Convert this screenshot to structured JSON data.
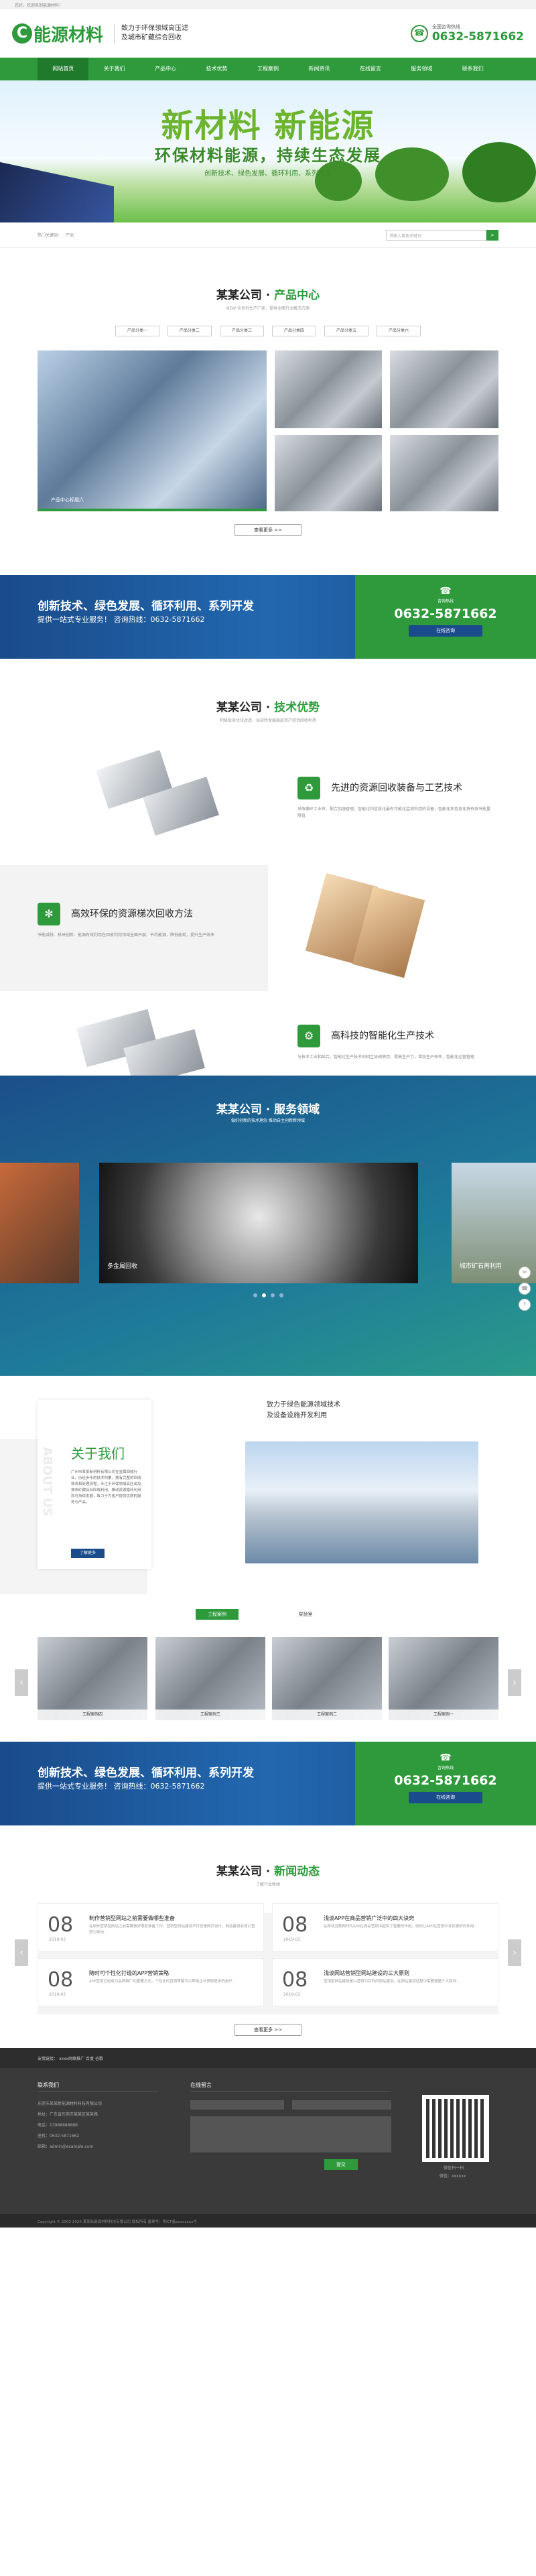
{
  "topbar": {
    "text": "您好，欢迎来到能源材料！"
  },
  "header": {
    "logo_letter": "C",
    "logo_name": "能源材料",
    "slogan_1": "致力于环保领域高压滤",
    "slogan_2": "及城市矿藏综合回收",
    "hotline_label": "全国咨询热线",
    "hotline": "0632-5871662"
  },
  "nav": [
    "网站首页",
    "关于我们",
    "产品中心",
    "技术优势",
    "工程案例",
    "新闻资讯",
    "在线留言",
    "服务领域",
    "联系我们"
  ],
  "banner": {
    "headline": "新材料 新能源",
    "subline": "环保材料能源，持续生态发展",
    "tags": "创新技术、绿色发展、循环利用、系列开发"
  },
  "search": {
    "hot_label": "热门关键词：",
    "hot_item": "产品",
    "placeholder": "请输入搜索关键词"
  },
  "products": {
    "title_a": "某某公司",
    "title_b": "产品中心",
    "sub_1": "NEW 全系列生产厂家，提供全面行业解决方案",
    "tabs": [
      "产品分类一",
      "产品分类二",
      "产品分类三",
      "产品分类四",
      "产品分类五",
      "产品分类六"
    ],
    "caption": "产品中心标题六",
    "more": "查看更多 >>"
  },
  "cta": {
    "line1": "创新技术、绿色发展、循环利用、系列开发",
    "line2": "提供一站式专业服务！ 咨询热线：0632-5871662",
    "label": "咨询热线",
    "phone": "0632-5871662",
    "button": "在线咨询"
  },
  "advantages": {
    "title_a": "某某公司",
    "title_b": "技术优势",
    "sub": "积极投身优化改造，治研所发展高层资产综合回收利用",
    "items": [
      {
        "title": "先进的资源回收装备与工艺技术",
        "desc": "采取循环工业声、配合加强管理，智能化和信息化最有可能化监测利用的设备，智能化和信息化将有效节能量降低"
      },
      {
        "title": "高效环保的资源梯次回收方法",
        "desc": "节能减排、科研创新、能源有效利用在回收利用领域全面开展，节约能源，降低能耗，提升生产效率"
      },
      {
        "title": "高科技的智能化生产技术",
        "desc": "与技术工业相结合，智能化生产技术的相互协调使用，提高生产力，增加生产效率，智能化运营管理"
      }
    ]
  },
  "service": {
    "title": "某某公司 · 服务领域",
    "sub": "做好创新的技术理念 推动自主创新新领域",
    "cards": [
      "多金属回收",
      "城市矿石再利用"
    ]
  },
  "about": {
    "heading": "关于我们",
    "watermark": "ABOUT US",
    "text": "广州市某某新材料有限公司在金属回收行业，历经多年的技术积累，拥有完整的回收体系和处理流程，专注于环保领域高压滤及城市矿藏综合回收利用，推动资源循环利用和可持续发展，致力于为客户提供优质的服务与产品。",
    "more": "了解更多",
    "right_1": "致力于绿色能源领域技术",
    "right_2": "及设备设施开发利用"
  },
  "cases": {
    "tabs": [
      "工程案例",
      "实验室"
    ],
    "items": [
      "工程案例四",
      "工程案例三",
      "工程案例二",
      "工程案例一"
    ]
  },
  "news": {
    "title_a": "某某公司",
    "title_b": "新闻动态",
    "sub": "了解行业新闻",
    "items": [
      {
        "day": "08",
        "ym": "2019-03",
        "title": "制作营销型网站之前需要做哪些准备",
        "desc": "在制作营销型网站之前需要做好哪些准备工作，营销型网站建设不仅仅是网页设计，网站建设必须以营销为导向..."
      },
      {
        "day": "08",
        "ym": "2019-03",
        "title": "浅谈APP在商品营销广泛中的四大诀窍",
        "desc": "在移动互联网时代APP在商品营销中起到了重要的作用，如何让APP在营销中发挥更好的作用..."
      },
      {
        "day": "08",
        "ym": "2019-03",
        "title": "随时可个性化打造的APP营销策略",
        "desc": "APP营销已经成为品牌推广的重要方式，个性化的营销策略可以帮助企业获取更多的用户..."
      },
      {
        "day": "08",
        "ym": "2019-03",
        "title": "浅谈网站营销型网站建设的三大原则",
        "desc": "营销型网站建设是以营销为目的的网站建设，在网站建设过程中需要遵循三大原则..."
      }
    ],
    "more": "查看更多 >>"
  },
  "links": {
    "label": "友情链接：",
    "items": "xxxx网络推广  百度  谷歌"
  },
  "footer": {
    "contact_title": "联系我们",
    "company": "东莞市某某新能源材料科技有限公司",
    "address": "地址：广东省东莞市某某区某某路",
    "phone": "电话：13988888888",
    "tel": "座机：0632-5871662",
    "email": "邮箱：admin@example.com",
    "msg_title": "在线留言",
    "submit": "提交",
    "qr_label": "微信扫一扫",
    "qr_sub": "微信：xxxxxx"
  },
  "copyright": "Copyright © 2002-2020 某某新能源材料科技有限公司 版权所有  备案号：粤ICP备xxxxxxxx号"
}
